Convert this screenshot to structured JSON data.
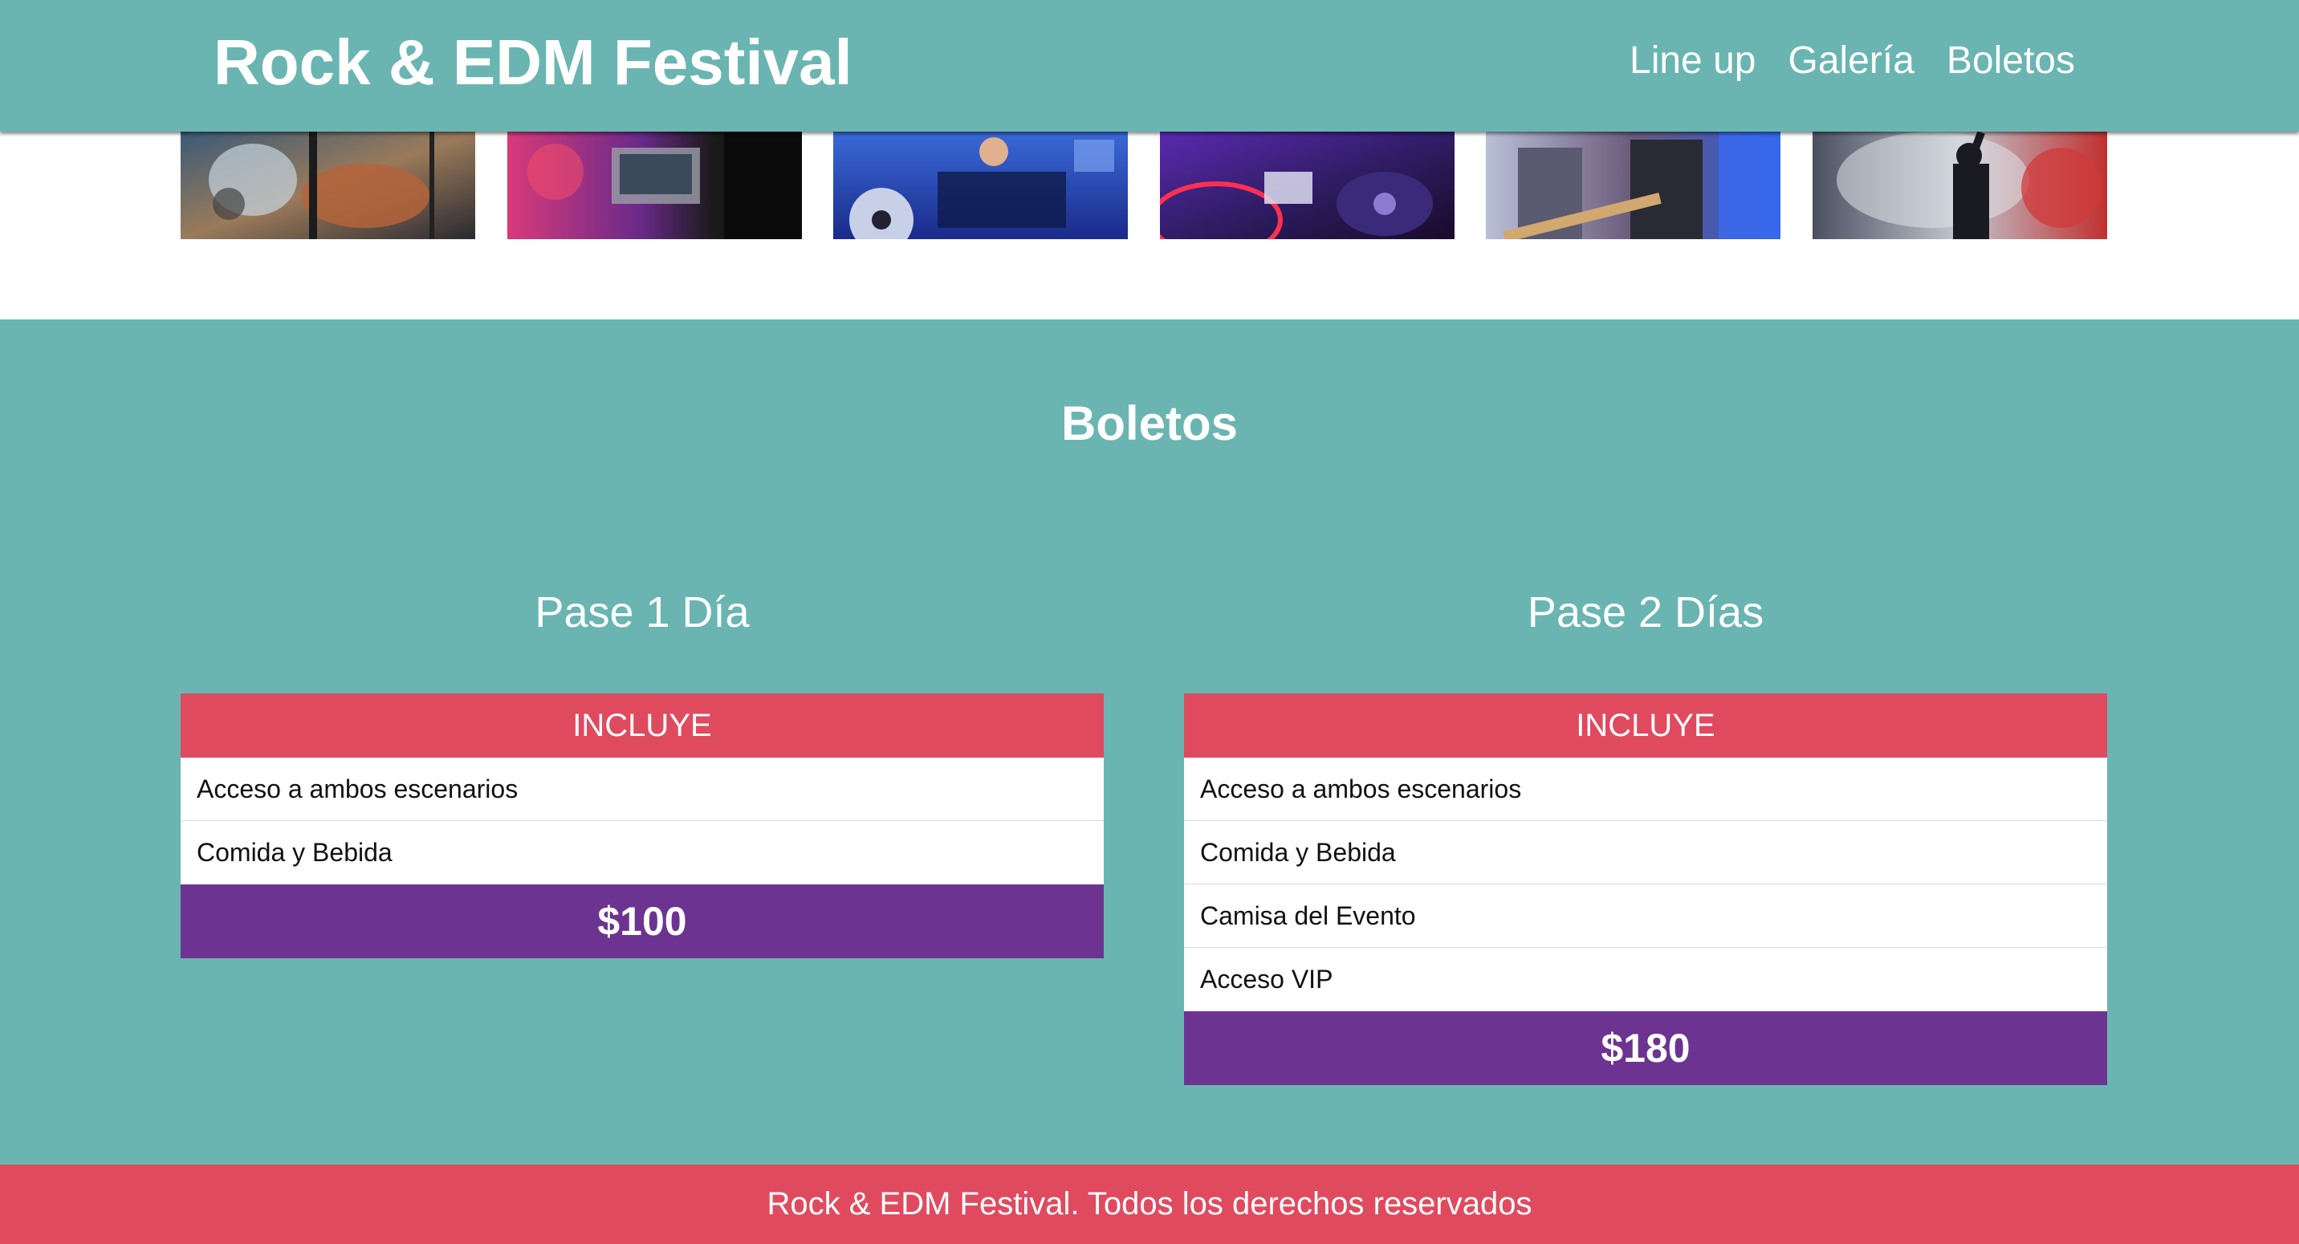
{
  "header": {
    "site_title": "Rock & EDM Festival",
    "nav": [
      "Line up",
      "Galería",
      "Boletos"
    ]
  },
  "gallery": {
    "images": [
      {
        "icon": "guitarist-photo"
      },
      {
        "icon": "dj-booth-photo"
      },
      {
        "icon": "dj-mixer-photo"
      },
      {
        "icon": "turntable-photo"
      },
      {
        "icon": "guitar-band-photo"
      },
      {
        "icon": "singer-smoke-photo"
      }
    ]
  },
  "tickets": {
    "title": "Boletos",
    "plans": [
      {
        "name": "Pase 1 Día",
        "includes_label": "INCLUYE",
        "features": [
          "Acceso a ambos escenarios",
          "Comida y Bebida"
        ],
        "price": "$100"
      },
      {
        "name": "Pase 2 Días",
        "includes_label": "INCLUYE",
        "features": [
          "Acceso a ambos escenarios",
          "Comida y Bebida",
          "Camisa del Evento",
          "Acceso VIP"
        ],
        "price": "$180"
      }
    ]
  },
  "footer": {
    "text": "Rock & EDM Festival. Todos los derechos reservados"
  },
  "colors": {
    "teal": "#6ab5b1",
    "red": "#e04a5f",
    "purple": "#6c3390"
  }
}
